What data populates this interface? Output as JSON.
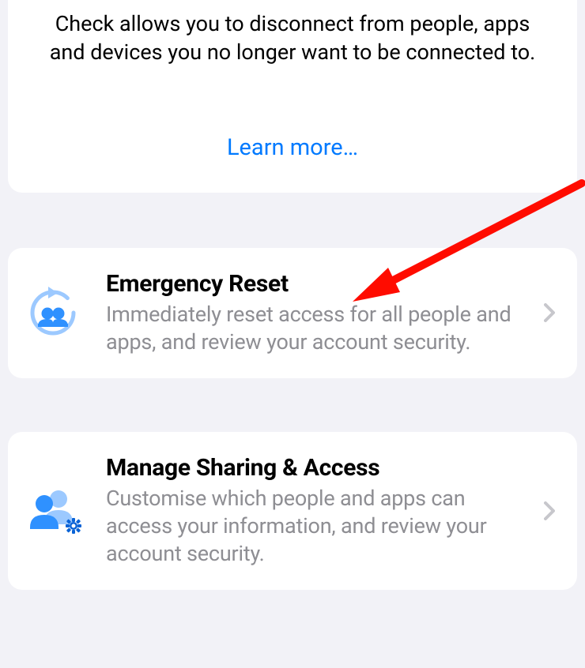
{
  "intro": {
    "description": "Check allows you to disconnect from people, apps and devices you no longer want to be connected to.",
    "learn_more": "Learn more…"
  },
  "options": {
    "emergency_reset": {
      "title": "Emergency Reset",
      "description": "Immediately reset access for all people and apps, and review your account security."
    },
    "manage_sharing": {
      "title": "Manage Sharing & Access",
      "description": "Customise which people and apps can access your information, and review your account security."
    }
  },
  "colors": {
    "link": "#007aff",
    "icon_light": "#71b2ff",
    "icon_dark": "#0a7aff",
    "secondary_text": "#8e8e93",
    "chevron": "#c7c7cc",
    "arrow": "#ff0000"
  }
}
